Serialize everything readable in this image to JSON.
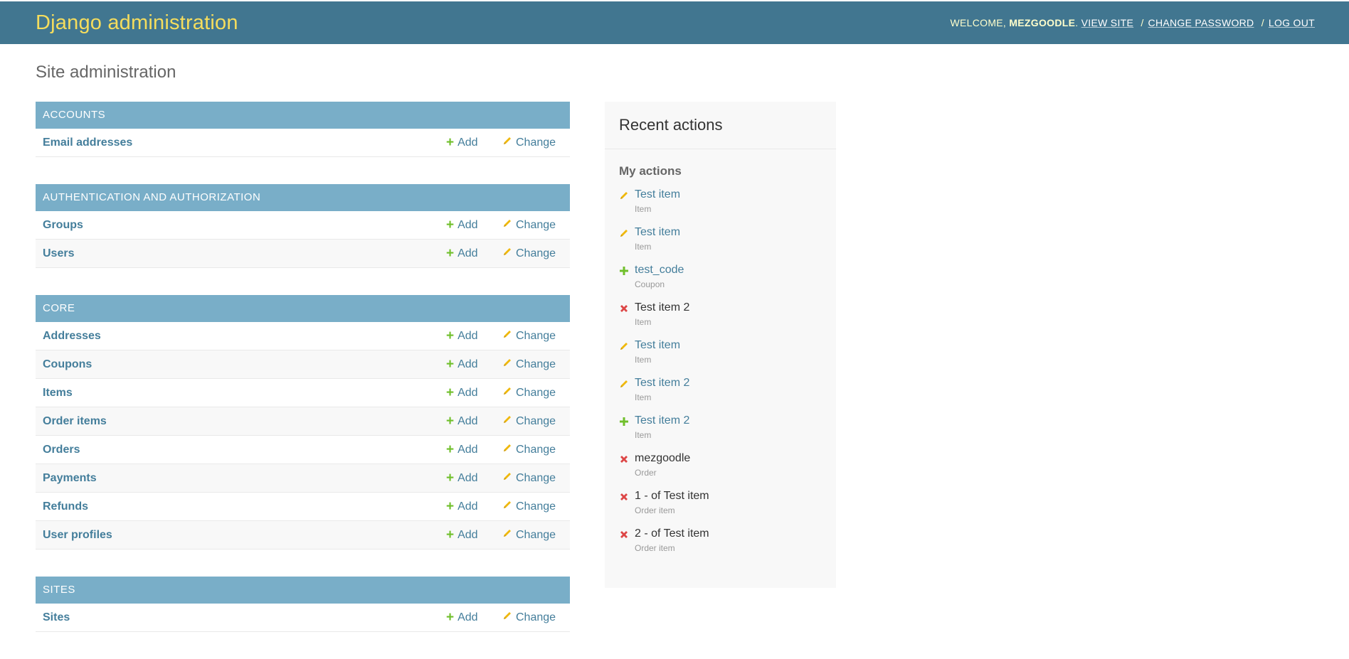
{
  "header": {
    "title": "Django administration",
    "welcome_prefix": "WELCOME, ",
    "username": "MEZGOODLE",
    "welcome_suffix": ".",
    "view_site": "VIEW SITE",
    "change_password": "CHANGE PASSWORD",
    "log_out": "LOG OUT",
    "separator": "/"
  },
  "page_title": "Site administration",
  "apps": [
    {
      "caption": "ACCOUNTS",
      "models": [
        "Email addresses"
      ]
    },
    {
      "caption": "AUTHENTICATION AND AUTHORIZATION",
      "models": [
        "Groups",
        "Users"
      ]
    },
    {
      "caption": "CORE",
      "models": [
        "Addresses",
        "Coupons",
        "Items",
        "Order items",
        "Orders",
        "Payments",
        "Refunds",
        "User profiles"
      ]
    },
    {
      "caption": "SITES",
      "models": [
        "Sites"
      ]
    }
  ],
  "row_actions": {
    "add": "Add",
    "change": "Change"
  },
  "recent_actions": {
    "title": "Recent actions",
    "subtitle": "My actions",
    "items": [
      {
        "name": "Test item",
        "type": "Item",
        "action": "change"
      },
      {
        "name": "Test item",
        "type": "Item",
        "action": "change"
      },
      {
        "name": "test_code",
        "type": "Coupon",
        "action": "add"
      },
      {
        "name": "Test item 2",
        "type": "Item",
        "action": "delete"
      },
      {
        "name": "Test item",
        "type": "Item",
        "action": "change"
      },
      {
        "name": "Test item 2",
        "type": "Item",
        "action": "change"
      },
      {
        "name": "Test item 2",
        "type": "Item",
        "action": "add"
      },
      {
        "name": "mezgoodle",
        "type": "Order",
        "action": "delete"
      },
      {
        "name": "1 - of Test item",
        "type": "Order item",
        "action": "delete"
      },
      {
        "name": "2 - of Test item",
        "type": "Order item",
        "action": "delete"
      }
    ]
  },
  "colors": {
    "header_bg": "#417690",
    "brand": "#f5dd5d",
    "caption_bg": "#79aec8",
    "link": "#447e9b",
    "add_icon": "#70bf2b",
    "change_icon": "#efb80b",
    "delete_icon": "#dd4646"
  },
  "icons": {
    "add": "plus-icon",
    "change": "pencil-icon",
    "delete": "x-icon"
  }
}
